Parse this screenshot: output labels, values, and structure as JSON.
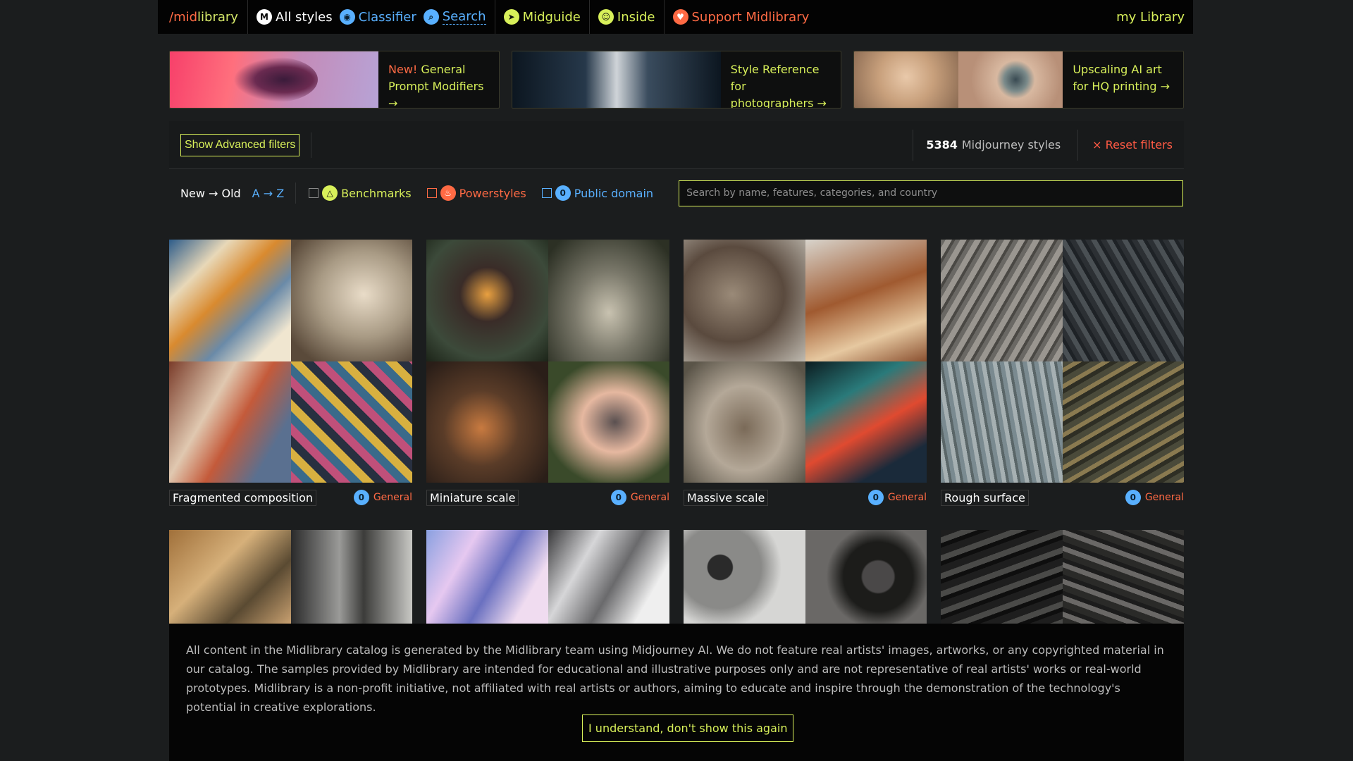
{
  "nav": {
    "logo": {
      "slash": "/",
      "mid": "mid",
      "lib": "library"
    },
    "items": [
      {
        "label": "All styles",
        "icon": "midlibrary-icon"
      },
      {
        "label": "Classifier",
        "icon": "classifier-icon"
      },
      {
        "label": "Search",
        "icon": "search-icon"
      },
      {
        "label": "Midguide",
        "icon": "compass-icon"
      },
      {
        "label": "Inside",
        "icon": "owl-icon"
      },
      {
        "label": "Support Midlibrary",
        "icon": "heart-icon"
      }
    ],
    "my_library": "my Library"
  },
  "promos": [
    {
      "new": "New!",
      "text": " General Prompt Modifiers →"
    },
    {
      "text": "Style Reference for photographers →"
    },
    {
      "text": "Upscaling AI art for HQ printing →"
    }
  ],
  "filters": {
    "advanced": "Show Advanced filters",
    "count": "5384",
    "count_label": "Midjourney styles",
    "reset": "× Reset filters"
  },
  "sort": {
    "new_old": "New → Old",
    "az": "A → Z",
    "toggles": [
      {
        "label": "Benchmarks",
        "icon": "benchmark-icon"
      },
      {
        "label": "Powerstyles",
        "icon": "flame-icon"
      },
      {
        "label": "Public domain",
        "icon": "public-domain-icon"
      }
    ],
    "search_placeholder": "Search by name, features, categories, and country"
  },
  "cards": [
    {
      "name": "Fragmented composition",
      "category": "General"
    },
    {
      "name": "Miniature scale",
      "category": "General"
    },
    {
      "name": "Massive scale",
      "category": "General"
    },
    {
      "name": "Rough surface",
      "category": "General"
    }
  ],
  "notice": {
    "text": "All content in the Midlibrary catalog is generated by the Midlibrary team using Midjourney AI. We do not feature real artists' images, artworks, or any copyrighted material in our catalog. The samples provided by Midlibrary are intended for educational and illustrative purposes only and are not representative of real artists' works or real-world prototypes. Midlibrary is a non-profit initiative, not affiliated with real artists or authors, aiming to educate and inspire through the demonstration of the technology's potential in creative explorations.",
    "button": "I understand, don't show this again"
  },
  "colors": {
    "accent_lime": "#d8f05a",
    "accent_blue": "#59b0ff",
    "accent_red": "#ff6a44",
    "background": "#1b1d1e"
  }
}
